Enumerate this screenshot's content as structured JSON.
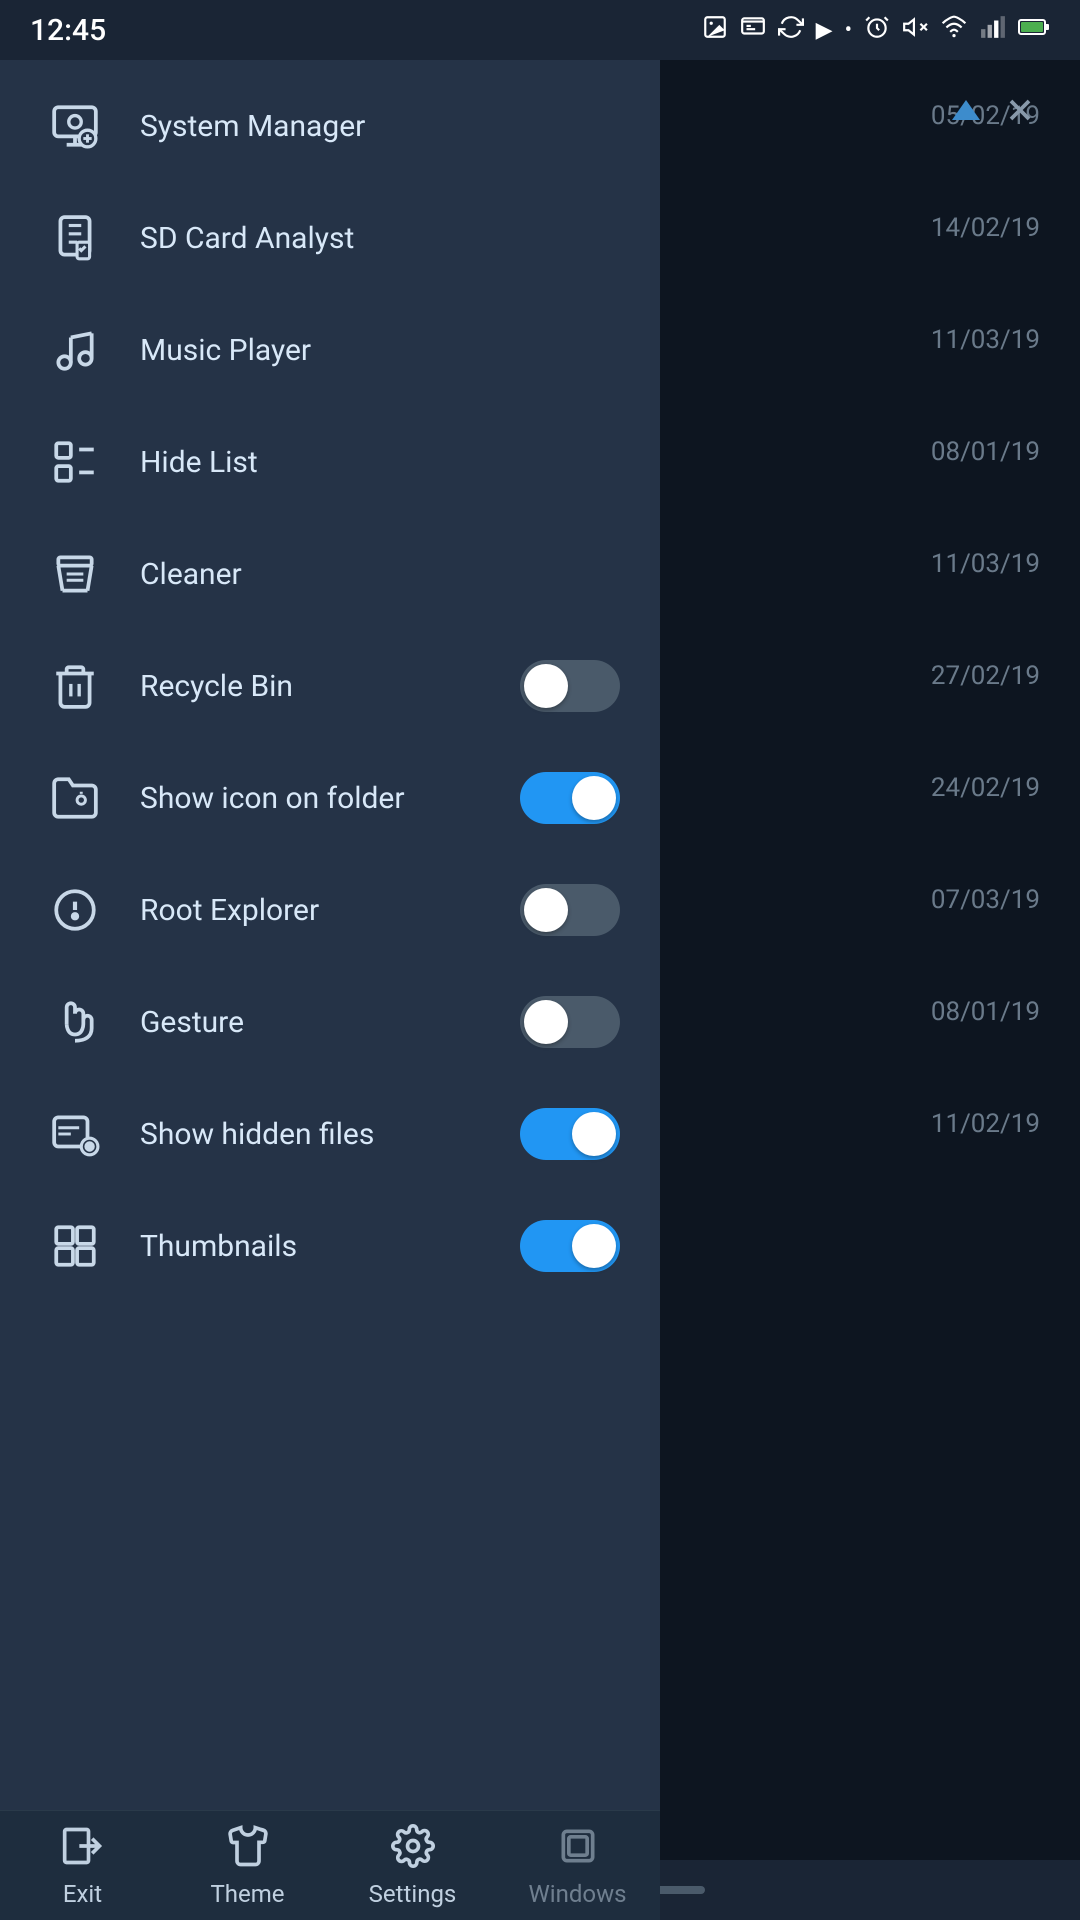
{
  "statusBar": {
    "time": "12:45"
  },
  "closeButton": {
    "label": "×"
  },
  "dates": [
    "05/02/19",
    "14/02/19",
    "11/03/19",
    "08/01/19",
    "11/03/19",
    "27/02/19",
    "24/02/19",
    "07/03/19",
    "08/01/19",
    "11/02/19"
  ],
  "menuItems": [
    {
      "id": "system-manager",
      "label": "System Manager",
      "hasToggle": false,
      "toggleOn": false
    },
    {
      "id": "sd-card-analyst",
      "label": "SD Card Analyst",
      "hasToggle": false,
      "toggleOn": false
    },
    {
      "id": "music-player",
      "label": "Music Player",
      "hasToggle": false,
      "toggleOn": false
    },
    {
      "id": "hide-list",
      "label": "Hide List",
      "hasToggle": false,
      "toggleOn": false
    },
    {
      "id": "cleaner",
      "label": "Cleaner",
      "hasToggle": false,
      "toggleOn": false
    },
    {
      "id": "recycle-bin",
      "label": "Recycle Bin",
      "hasToggle": true,
      "toggleOn": false
    },
    {
      "id": "show-icon-on-folder",
      "label": "Show icon on folder",
      "hasToggle": true,
      "toggleOn": true
    },
    {
      "id": "root-explorer",
      "label": "Root Explorer",
      "hasToggle": true,
      "toggleOn": false
    },
    {
      "id": "gesture",
      "label": "Gesture",
      "hasToggle": true,
      "toggleOn": false
    },
    {
      "id": "show-hidden-files",
      "label": "Show hidden files",
      "hasToggle": true,
      "toggleOn": true
    },
    {
      "id": "thumbnails",
      "label": "Thumbnails",
      "hasToggle": true,
      "toggleOn": true
    }
  ],
  "bottomNav": [
    {
      "id": "exit",
      "label": "Exit"
    },
    {
      "id": "theme",
      "label": "Theme"
    },
    {
      "id": "settings",
      "label": "Settings"
    },
    {
      "id": "windows",
      "label": "Windows"
    }
  ]
}
